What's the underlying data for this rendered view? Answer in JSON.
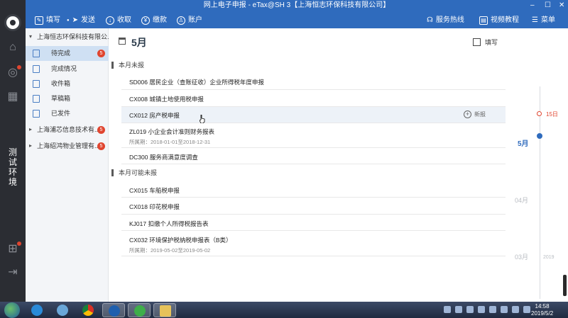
{
  "window": {
    "title": "网上电子申报 - eTax@SH 3【上海恒志环保科技有限公司】",
    "controls": [
      "–",
      "☐",
      "✕"
    ]
  },
  "toolbar": {
    "fill": "填写",
    "send": "发送",
    "receive": "收取",
    "payment": "缴款",
    "account": "账户",
    "hotline": "服务热线",
    "tutorial": "视频教程",
    "menu": "菜单"
  },
  "leftbar": {
    "env_label": "测试环境"
  },
  "sidebar": {
    "companies": [
      {
        "name": "上海恒志环保科技有限公...",
        "arrow": "▾",
        "badge": ""
      },
      {
        "name": "上海浦芯信息技术有...",
        "arrow": "▸",
        "badge": "5"
      },
      {
        "name": "上海绍鸿物业管理有...",
        "arrow": "▸",
        "badge": "5"
      }
    ],
    "items": [
      {
        "label": "待完成",
        "badge": "5"
      },
      {
        "label": "完成情况"
      },
      {
        "label": "收件箱"
      },
      {
        "label": "草稿箱"
      },
      {
        "label": "已发件"
      }
    ]
  },
  "main": {
    "month": "5月",
    "fill_label": "填写",
    "section1": "本月未报",
    "section2": "本月可能未报",
    "rows1": [
      {
        "title": "SD006 居民企业（查账征收）企业所得税年度申报",
        "sub": ""
      },
      {
        "title": "CX008 城镇土地使用税申报",
        "sub": ""
      },
      {
        "title": "CX012 房产税申报",
        "sub": "",
        "action": "新报"
      },
      {
        "title": "ZL019 小企业会计准则财务报表",
        "sub": "所属期：2018-01-01至2018-12-31"
      },
      {
        "title": "DC300 服务商满意度调查",
        "sub": ""
      }
    ],
    "rows2": [
      {
        "title": "CX015 车船税申报",
        "sub": ""
      },
      {
        "title": "CX018 印花税申报",
        "sub": ""
      },
      {
        "title": "KJ017 扣缴个人所得税报告表",
        "sub": ""
      },
      {
        "title": "CX032 环境保护税纳税申报表（B类）",
        "sub": "所属期：2019-05-02至2019-05-02"
      }
    ]
  },
  "timeline": {
    "deadline": "15日",
    "current": "5月",
    "prev1": "04月",
    "prev2": "03月",
    "year": "2019"
  },
  "taskbar": {
    "time": "14:58",
    "date": "2019/5/2"
  },
  "colors": {
    "accent": "#2f6bbd",
    "badge": "#e0452f"
  }
}
